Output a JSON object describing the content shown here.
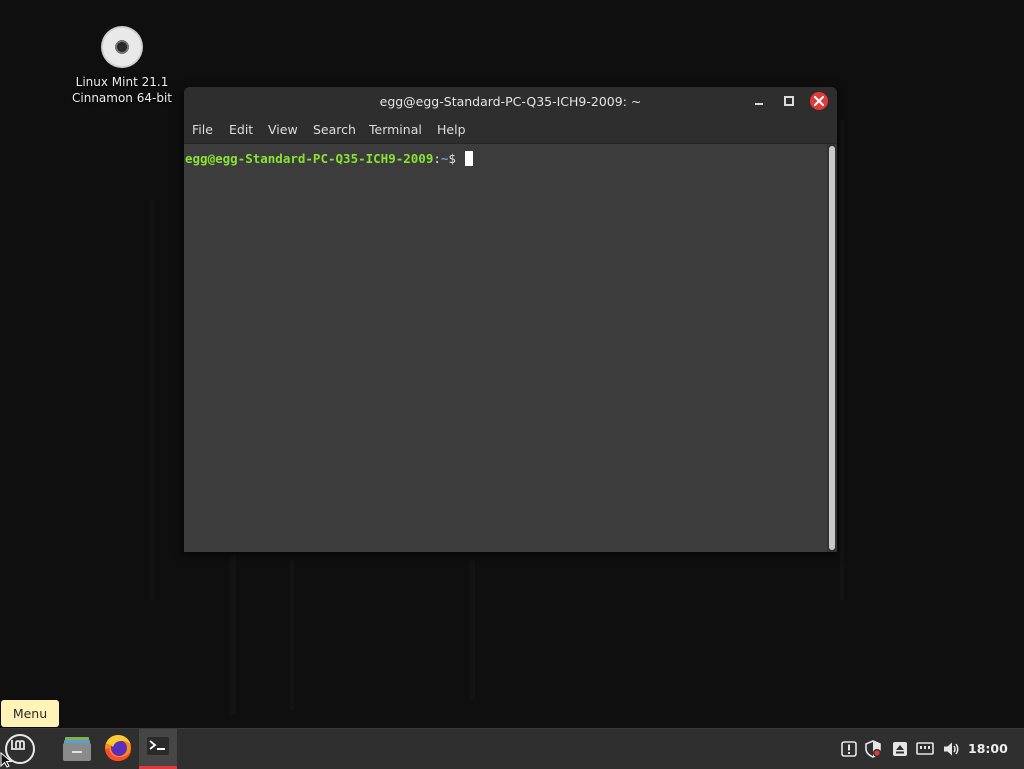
{
  "desktop": {
    "icon_line1": "Linux Mint 21.1",
    "icon_line2": "Cinnamon 64-bit",
    "icon": "disc-icon"
  },
  "window": {
    "title": "egg@egg-Standard-PC-Q35-ICH9-2009: ~",
    "menu": [
      "File",
      "Edit",
      "View",
      "Search",
      "Terminal",
      "Help"
    ],
    "close_color": "#e03a3a"
  },
  "terminal": {
    "user_host": "egg@egg-Standard-PC-Q35-ICH9-2009",
    "separator": ":",
    "path": "~",
    "symbol": "$ "
  },
  "tooltip": {
    "text": "Menu"
  },
  "panel": {
    "clock": "18:00",
    "launchers": [
      "files-icon",
      "firefox-icon",
      "terminal-icon"
    ],
    "tray": [
      "notifications-icon",
      "update-shield-icon",
      "removable-drive-icon",
      "network-icon",
      "volume-icon"
    ]
  },
  "colors": {
    "prompt_user": "#8ae234",
    "prompt_path": "#729fcf",
    "accent": "#e03a3a",
    "tooltip_bg": "#fff3b8"
  }
}
